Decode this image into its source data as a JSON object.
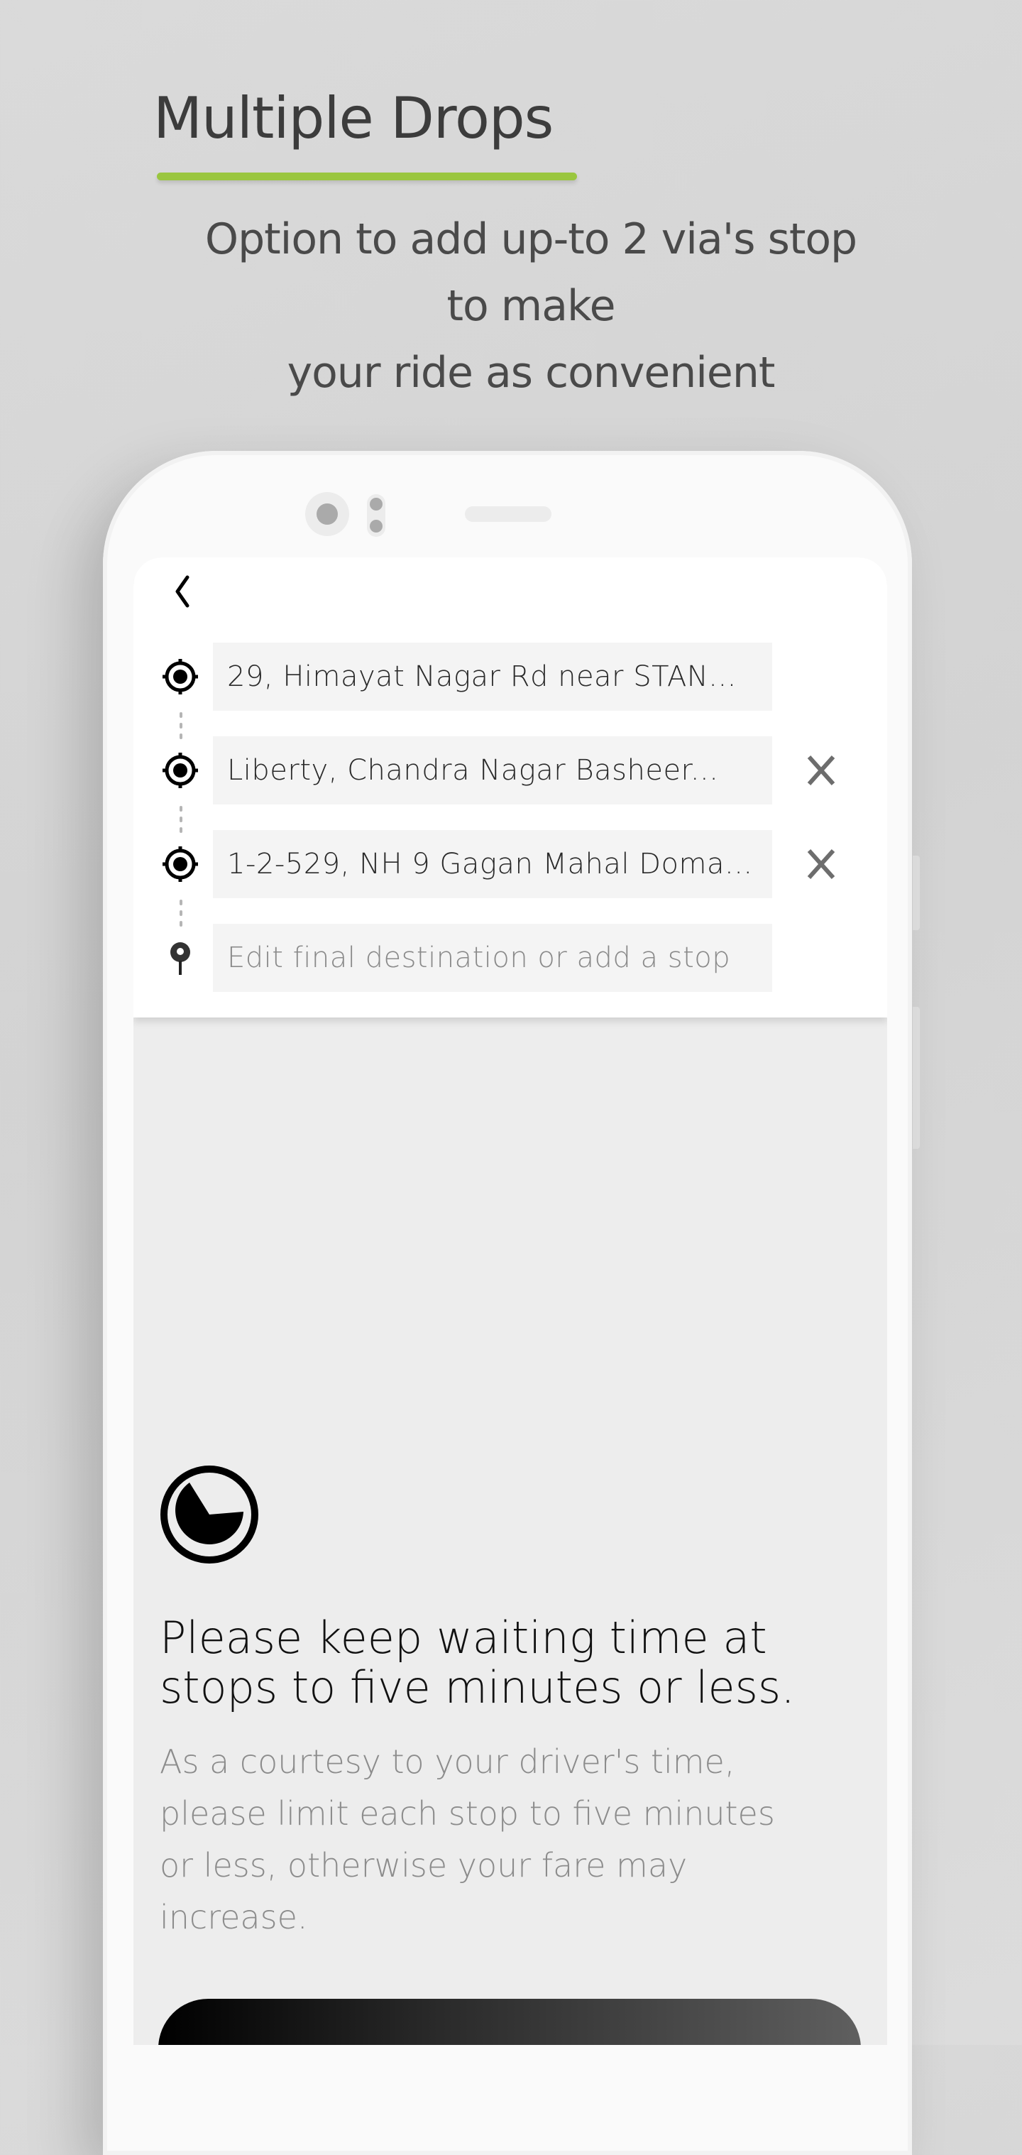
{
  "promo": {
    "title": "Multiple Drops",
    "accent_color": "#9ac63f",
    "subtitle_lines": [
      "Option to add up-to 2 via's stop",
      "to make",
      "your ride as convenient"
    ]
  },
  "app": {
    "back_icon": "chevron-left-icon",
    "stops": [
      {
        "type": "pickup",
        "icon": "target-icon",
        "value": "29, Himayat Nagar Rd near STAN...",
        "removable": false
      },
      {
        "type": "via",
        "icon": "target-icon",
        "value": "Liberty, Chandra Nagar Basheer...",
        "removable": true,
        "remove_icon": "close-icon"
      },
      {
        "type": "via",
        "icon": "target-icon",
        "value": "1-2-529, NH 9 Gagan Mahal Doma...",
        "removable": true,
        "remove_icon": "close-icon"
      },
      {
        "type": "destination",
        "icon": "map-pin-icon",
        "value": "",
        "placeholder": "Edit final destination or add a stop",
        "removable": false
      }
    ],
    "notice": {
      "icon": "clock-icon",
      "heading_lines": [
        "Please keep waiting time at",
        "stops to five minutes or less."
      ],
      "body_lines": [
        "As a courtesy to your driver's time,",
        "please limit each stop to five minutes",
        "or less, otherwise your fare may",
        "increase."
      ]
    }
  }
}
